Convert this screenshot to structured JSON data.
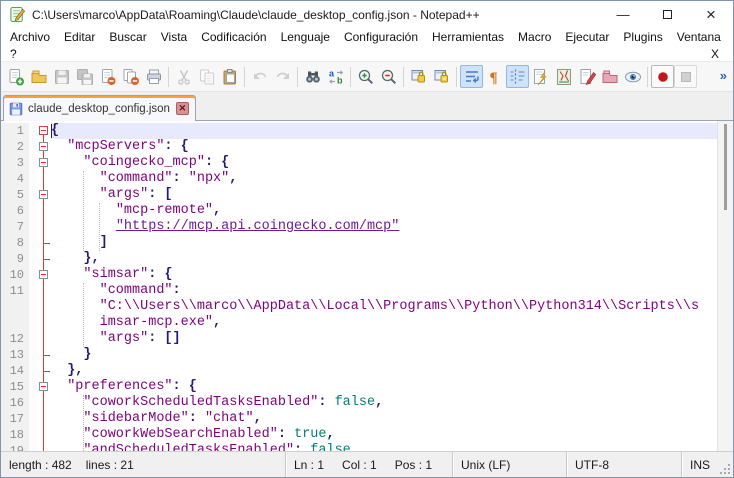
{
  "window_title": "C:\\Users\\marco\\AppData\\Roaming\\Claude\\claude_desktop_config.json - Notepad++",
  "window_controls": {
    "minimize": "—",
    "close": "×"
  },
  "menu": {
    "items": [
      "Archivo",
      "Editar",
      "Buscar",
      "Vista",
      "Codificación",
      "Lenguaje",
      "Configuración",
      "Herramientas",
      "Macro",
      "Ejecutar",
      "Plugins",
      "Ventana"
    ],
    "row2_left": "?",
    "row2_right": "X"
  },
  "toolbar": {
    "groups": [
      [
        "new-file",
        "open-folder",
        "save",
        "save-all",
        "close-file",
        "close-all",
        "print"
      ],
      [
        "cut",
        "copy",
        "paste"
      ],
      [
        "undo",
        "redo"
      ],
      [
        "find",
        "replace"
      ],
      [
        "zoom-in",
        "zoom-out"
      ],
      [
        "sync-vertical-scroll",
        "sync-horizontal-scroll"
      ],
      [
        "word-wrap",
        "show-all-characters",
        "indent-guide",
        "function-list",
        "document-map",
        "document-list",
        "folder-as-workspace",
        "monitoring"
      ],
      [
        "macro-record",
        "macro-stop"
      ]
    ],
    "disabled": [
      "save",
      "save-all",
      "cut",
      "copy",
      "undo",
      "redo",
      "macro-stop"
    ],
    "active": [
      "word-wrap",
      "indent-guide"
    ],
    "framed": [
      "macro-record",
      "macro-stop"
    ],
    "overflow": "»"
  },
  "tab": {
    "label": "claude_desktop_config.json",
    "close": "✕"
  },
  "editor": {
    "rows": [
      {
        "n": "1",
        "f": "box1",
        "segs": [
          [
            "p",
            "{"
          ]
        ]
      },
      {
        "n": "2",
        "f": "box",
        "segs": [
          [
            "d",
            "  "
          ],
          [
            "s",
            "\"mcpServers\""
          ],
          [
            "p",
            ": {"
          ]
        ]
      },
      {
        "n": "3",
        "f": "box",
        "segs": [
          [
            "d",
            "    "
          ],
          [
            "s",
            "\"coingecko_mcp\""
          ],
          [
            "p",
            ": {"
          ]
        ]
      },
      {
        "n": "4",
        "f": "v",
        "segs": [
          [
            "d",
            "      "
          ],
          [
            "s",
            "\"command\""
          ],
          [
            "p",
            ":"
          ],
          [
            "d",
            " "
          ],
          [
            "s",
            "\"npx\""
          ],
          [
            "p",
            ","
          ]
        ]
      },
      {
        "n": "5",
        "f": "box",
        "segs": [
          [
            "d",
            "      "
          ],
          [
            "s",
            "\"args\""
          ],
          [
            "p",
            ": ["
          ]
        ]
      },
      {
        "n": "6",
        "f": "v",
        "segs": [
          [
            "d",
            "        "
          ],
          [
            "s",
            "\"mcp-remote\""
          ],
          [
            "p",
            ","
          ]
        ]
      },
      {
        "n": "7",
        "f": "v",
        "segs": [
          [
            "d",
            "        "
          ],
          [
            "u",
            "\"https://mcp.api.coingecko.com/mcp\""
          ]
        ]
      },
      {
        "n": "8",
        "f": "t",
        "segs": [
          [
            "d",
            "      "
          ],
          [
            "p",
            "]"
          ]
        ]
      },
      {
        "n": "9",
        "f": "t",
        "segs": [
          [
            "d",
            "    "
          ],
          [
            "p",
            "},"
          ]
        ]
      },
      {
        "n": "10",
        "f": "box",
        "segs": [
          [
            "d",
            "    "
          ],
          [
            "s",
            "\"simsar\""
          ],
          [
            "p",
            ": {"
          ]
        ]
      },
      {
        "n": "11",
        "f": "v",
        "segs": [
          [
            "d",
            "      "
          ],
          [
            "s",
            "\"command\""
          ],
          [
            "p",
            ":"
          ]
        ]
      },
      {
        "n": "",
        "f": "v",
        "segs": [
          [
            "d",
            "      "
          ],
          [
            "s",
            "\"C:\\\\Users\\\\marco\\\\AppData\\\\Local\\\\Programs\\\\Python\\\\Python314\\\\Scripts\\\\s"
          ]
        ]
      },
      {
        "n": "",
        "f": "v",
        "segs": [
          [
            "d",
            "      "
          ],
          [
            "s",
            "imsar-mcp.exe\""
          ],
          [
            "p",
            ","
          ]
        ]
      },
      {
        "n": "12",
        "f": "v",
        "segs": [
          [
            "d",
            "      "
          ],
          [
            "s",
            "\"args\""
          ],
          [
            "p",
            ": []"
          ]
        ]
      },
      {
        "n": "13",
        "f": "t",
        "segs": [
          [
            "d",
            "    "
          ],
          [
            "p",
            "}"
          ]
        ]
      },
      {
        "n": "14",
        "f": "t",
        "segs": [
          [
            "d",
            "  "
          ],
          [
            "p",
            "},"
          ]
        ]
      },
      {
        "n": "15",
        "f": "box",
        "segs": [
          [
            "d",
            "  "
          ],
          [
            "s",
            "\"preferences\""
          ],
          [
            "p",
            ": {"
          ]
        ]
      },
      {
        "n": "16",
        "f": "v",
        "segs": [
          [
            "d",
            "    "
          ],
          [
            "s",
            "\"coworkScheduledTasksEnabled\""
          ],
          [
            "p",
            ":"
          ],
          [
            "d",
            " "
          ],
          [
            "b",
            "false"
          ],
          [
            "p",
            ","
          ]
        ]
      },
      {
        "n": "17",
        "f": "v",
        "segs": [
          [
            "d",
            "    "
          ],
          [
            "s",
            "\"sidebarMode\""
          ],
          [
            "p",
            ":"
          ],
          [
            "d",
            " "
          ],
          [
            "s",
            "\"chat\""
          ],
          [
            "p",
            ","
          ]
        ]
      },
      {
        "n": "18",
        "f": "v",
        "segs": [
          [
            "d",
            "    "
          ],
          [
            "s",
            "\"coworkWebSearchEnabled\""
          ],
          [
            "p",
            ":"
          ],
          [
            "d",
            " "
          ],
          [
            "b",
            "true"
          ],
          [
            "p",
            ","
          ]
        ]
      },
      {
        "n": "19",
        "f": "v",
        "segs": [
          [
            "d",
            "    "
          ],
          [
            "s",
            "\"andScheduledTasksEnabled\""
          ],
          [
            "p",
            ":"
          ],
          [
            "d",
            " "
          ],
          [
            "b",
            "false"
          ]
        ]
      }
    ]
  },
  "status_bar": {
    "length_label": "length : 482",
    "lines_label": "lines : 21",
    "line": "Ln : 1",
    "column": "Col : 1",
    "position": "Pos : 1",
    "eol": "Unix (LF)",
    "encoding": "UTF-8",
    "insert_mode": "INS"
  },
  "colors": {
    "active_tab_stripe": "#f9a13a",
    "json_string": "#7f007f",
    "json_punctuation": "#241a70",
    "json_boolean": "#007d76",
    "url_link": "#6a1b9a",
    "fold_marker": "#ee3333",
    "current_line_highlight": "#e7eafc",
    "toolbar_active_bg": "#cfe3f8"
  }
}
